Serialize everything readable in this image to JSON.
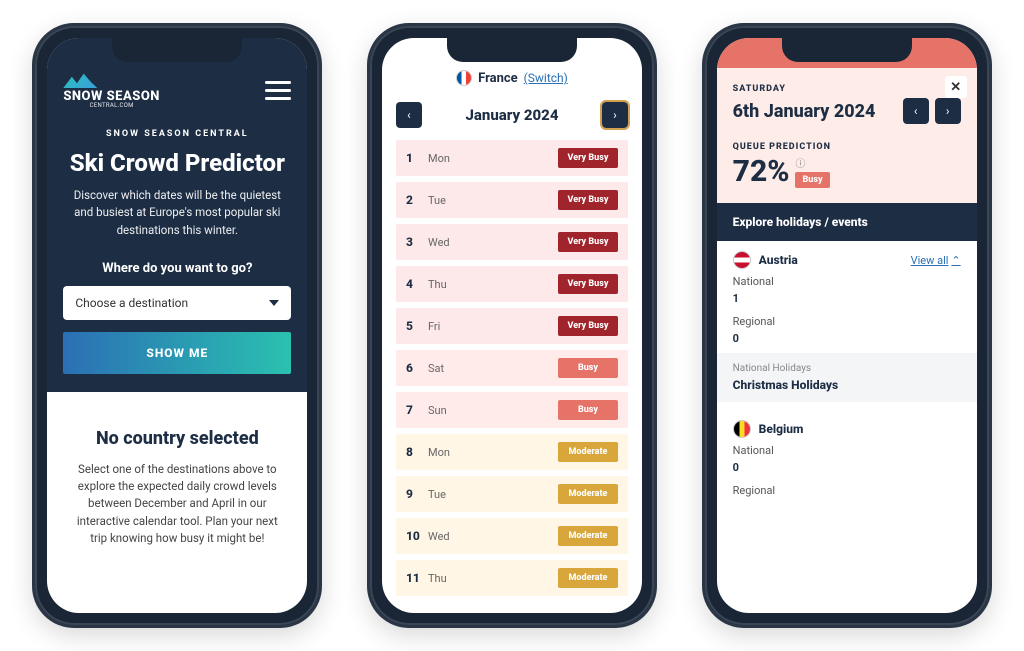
{
  "screen1": {
    "brand_line1": "SNOW SEASON",
    "brand_line2": "CENTRAL.COM",
    "subtitle": "SNOW SEASON CENTRAL",
    "title": "Ski Crowd Predictor",
    "description": "Discover which dates will be the quietest and busiest at Europe's most popular ski destinations this winter.",
    "form_label": "Where do you want to go?",
    "select_placeholder": "Choose a destination",
    "button_label": "SHOW ME",
    "card_title": "No country selected",
    "card_body": "Select one of the destinations above to explore the expected daily crowd levels between December and April in our interactive calendar tool. Plan your next trip knowing how busy it might be!"
  },
  "screen2": {
    "country": "France",
    "switch_label": "(Switch)",
    "month": "January 2024",
    "days": [
      {
        "num": "1",
        "dow": "Mon",
        "level": "vbusy",
        "label": "Very Busy"
      },
      {
        "num": "2",
        "dow": "Tue",
        "level": "vbusy",
        "label": "Very Busy"
      },
      {
        "num": "3",
        "dow": "Wed",
        "level": "vbusy",
        "label": "Very Busy"
      },
      {
        "num": "4",
        "dow": "Thu",
        "level": "vbusy",
        "label": "Very Busy"
      },
      {
        "num": "5",
        "dow": "Fri",
        "level": "vbusy",
        "label": "Very Busy"
      },
      {
        "num": "6",
        "dow": "Sat",
        "level": "busy",
        "label": "Busy"
      },
      {
        "num": "7",
        "dow": "Sun",
        "level": "busy",
        "label": "Busy"
      },
      {
        "num": "8",
        "dow": "Mon",
        "level": "mod",
        "label": "Moderate"
      },
      {
        "num": "9",
        "dow": "Tue",
        "level": "mod",
        "label": "Moderate"
      },
      {
        "num": "10",
        "dow": "Wed",
        "level": "mod",
        "label": "Moderate"
      },
      {
        "num": "11",
        "dow": "Thu",
        "level": "mod",
        "label": "Moderate"
      }
    ]
  },
  "screen3": {
    "dow": "SATURDAY",
    "date": "6th January 2024",
    "queue_label": "QUEUE PREDICTION",
    "percent": "72%",
    "info_icon": "ⓘ",
    "busy_label": "Busy",
    "explore_label": "Explore holidays / events",
    "view_all": "View all",
    "countries": [
      {
        "name": "Austria",
        "flag": "at",
        "national_label": "National",
        "national_count": "1",
        "regional_label": "Regional",
        "regional_count": "0",
        "detail_label": "National Holidays",
        "detail_value": "Christmas Holidays"
      },
      {
        "name": "Belgium",
        "flag": "be",
        "national_label": "National",
        "national_count": "0",
        "regional_label": "Regional"
      }
    ]
  }
}
